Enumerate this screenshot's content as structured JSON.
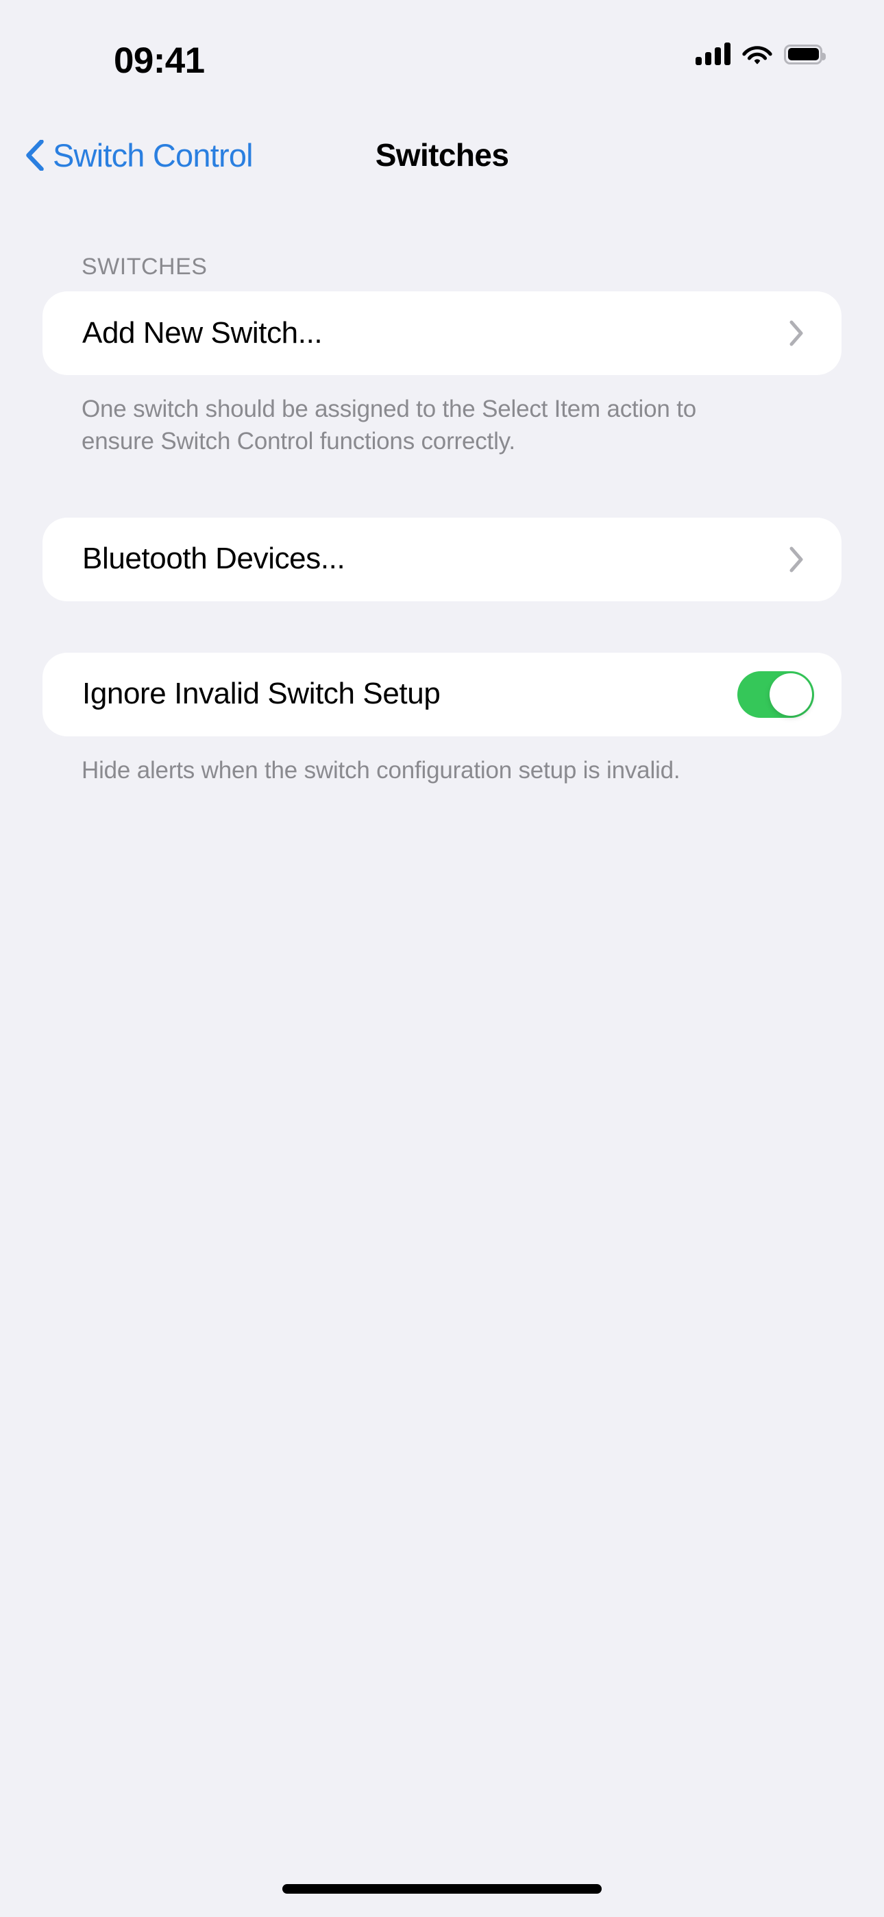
{
  "status_bar": {
    "time": "09:41",
    "cellular_icon": "cellular-signal-icon",
    "cellular_bars": 4,
    "wifi_icon": "wifi-icon",
    "battery_icon": "battery-icon",
    "battery_level": 100
  },
  "nav": {
    "back_label": "Switch Control",
    "back_icon": "chevron-left-icon",
    "title": "Switches"
  },
  "sections": [
    {
      "header": "SWITCHES",
      "rows": [
        {
          "label": "Add New Switch...",
          "accessory": "chevron-right-icon"
        }
      ],
      "footer": "One switch should be assigned to the Select Item action to ensure Switch Control functions correctly."
    },
    {
      "header": "",
      "rows": [
        {
          "label": "Bluetooth Devices...",
          "accessory": "chevron-right-icon"
        }
      ],
      "footer": ""
    },
    {
      "header": "",
      "rows": [
        {
          "label": "Ignore Invalid Switch Setup",
          "accessory": "toggle",
          "toggle_on": true
        }
      ],
      "footer": "Hide alerts when the switch configuration setup is invalid."
    }
  ],
  "colors": {
    "background": "#F1F1F6",
    "card": "#FFFFFF",
    "accent_blue": "#2A7FE0",
    "toggle_on_green": "#35C759",
    "secondary_text": "#8A8A8F",
    "chevron_gray": "#B0B0B5"
  },
  "home_indicator": "home-indicator"
}
